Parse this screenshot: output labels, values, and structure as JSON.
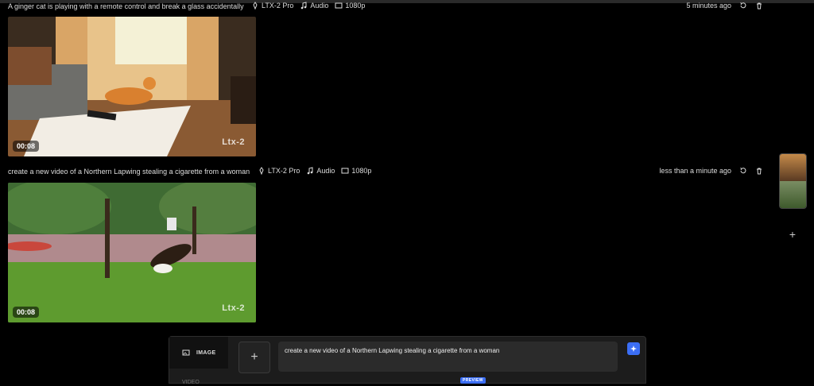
{
  "generations": [
    {
      "prompt": "A ginger cat is playing with a remote control and break a glass accidentally",
      "model": "LTX-2 Pro",
      "audio": "Audio",
      "resolution": "1080p",
      "time": "5 minutes ago",
      "duration": "00:08",
      "brand": "Ltx-2"
    },
    {
      "prompt": "create a new video of a Northern Lapwing stealing a cigarette from a woman",
      "model": "LTX-2 Pro",
      "audio": "Audio",
      "resolution": "1080p",
      "time": "less than a minute ago",
      "duration": "00:08",
      "brand": "Ltx-2"
    }
  ],
  "composer": {
    "mode_image": "IMAGE",
    "mode_video": "VIDEO",
    "prompt_text": "create a new video of a Northern Lapwing stealing a cigarette from a woman",
    "preview_badge": "PREVIEW"
  },
  "colors": {
    "accent": "#3b6ef5",
    "background": "#000000"
  },
  "icons": [
    "model-icon",
    "audio-note-icon",
    "resolution-icon",
    "retry-icon",
    "trash-icon",
    "image-icon",
    "plus-icon",
    "sparkle-icon"
  ]
}
